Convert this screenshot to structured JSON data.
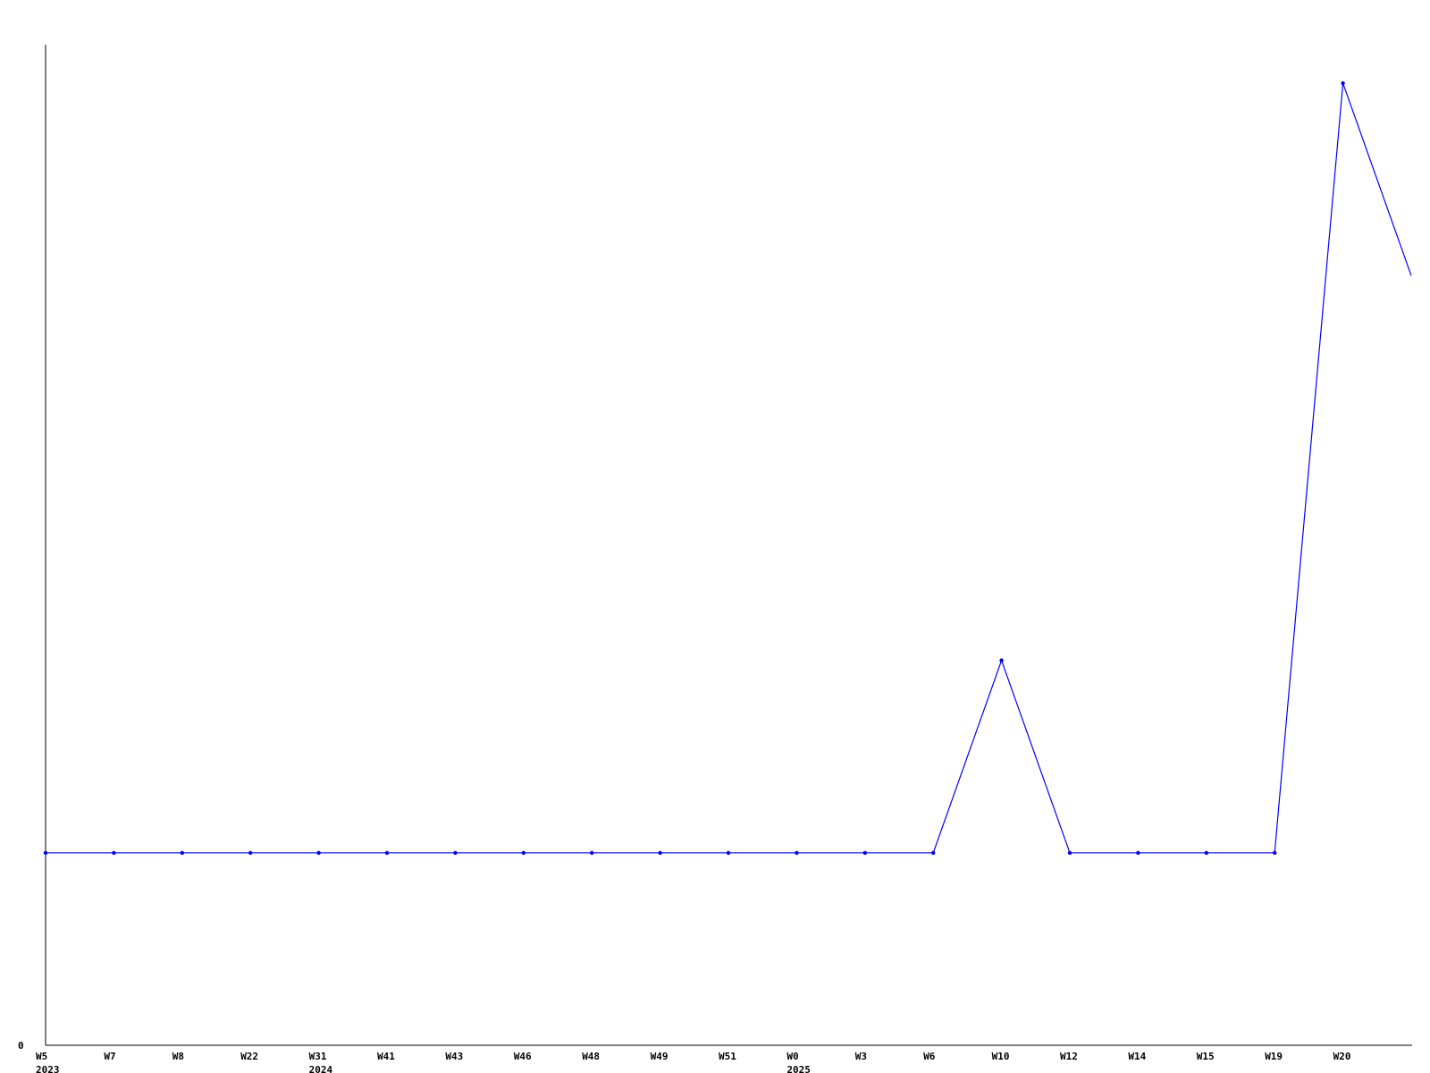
{
  "chart_data": {
    "type": "line",
    "title": "",
    "xlabel": "",
    "ylabel": "",
    "ytick_labels": [
      "0"
    ],
    "grid": false,
    "categories": [
      "W5",
      "W7",
      "W8",
      "W22",
      "W31",
      "W41",
      "W43",
      "W46",
      "W48",
      "W49",
      "W51",
      "W0",
      "W3",
      "W6",
      "W10",
      "W12",
      "W14",
      "W15",
      "W19",
      "W20",
      ""
    ],
    "year_labels": [
      "2023",
      "",
      "",
      "",
      "2024",
      "",
      "",
      "",
      "",
      "",
      "",
      "2025",
      "",
      "",
      "",
      "",
      "",
      "",
      "",
      "",
      ""
    ],
    "series": [
      {
        "color": "#0000ff",
        "values": [
          1,
          1,
          1,
          1,
          1,
          1,
          1,
          1,
          1,
          1,
          1,
          1,
          1,
          1,
          2,
          1,
          1,
          1,
          1,
          5,
          4
        ]
      }
    ],
    "ylim": [
      0,
      5.2
    ]
  }
}
